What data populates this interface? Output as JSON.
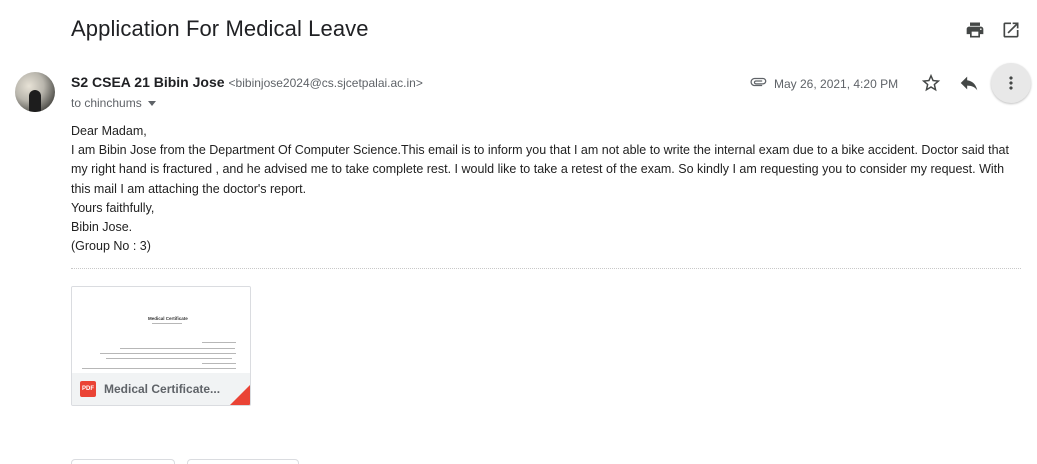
{
  "email": {
    "subject": "Application For Medical Leave",
    "sender_name": "S2 CSEA 21 Bibin Jose",
    "sender_email": "<bibinjose2024@cs.sjcetpalai.ac.in>",
    "to_text": "to chinchums",
    "date": "May 26, 2021, 4:20 PM",
    "body_lines": [
      "Dear Madam,",
      "I am Bibin Jose from the Department Of Computer Science.This email is to inform you that I am not able to write the internal exam due to a bike accident. Doctor said that my right hand is fractured , and he advised me to take complete rest. I would like to take a retest of the exam. So kindly I am requesting you to consider my request. With this mail I am attaching the doctor's report.",
      "Yours faithfully,",
      "Bibin Jose.",
      "(Group No : 3)"
    ]
  },
  "attachment": {
    "name": "Medical Certificate...",
    "badge": "PDF",
    "preview_title": "Medical Certificate"
  },
  "icons": {
    "print": "print-icon",
    "open_new_window": "open-in-new-window-icon",
    "attachment": "paperclip-icon",
    "star": "star-icon",
    "reply": "reply-icon",
    "more": "more-vert-icon"
  },
  "colors": {
    "accent_pdf": "#ea4335",
    "text_primary": "#202124",
    "text_secondary": "#5f6368"
  }
}
